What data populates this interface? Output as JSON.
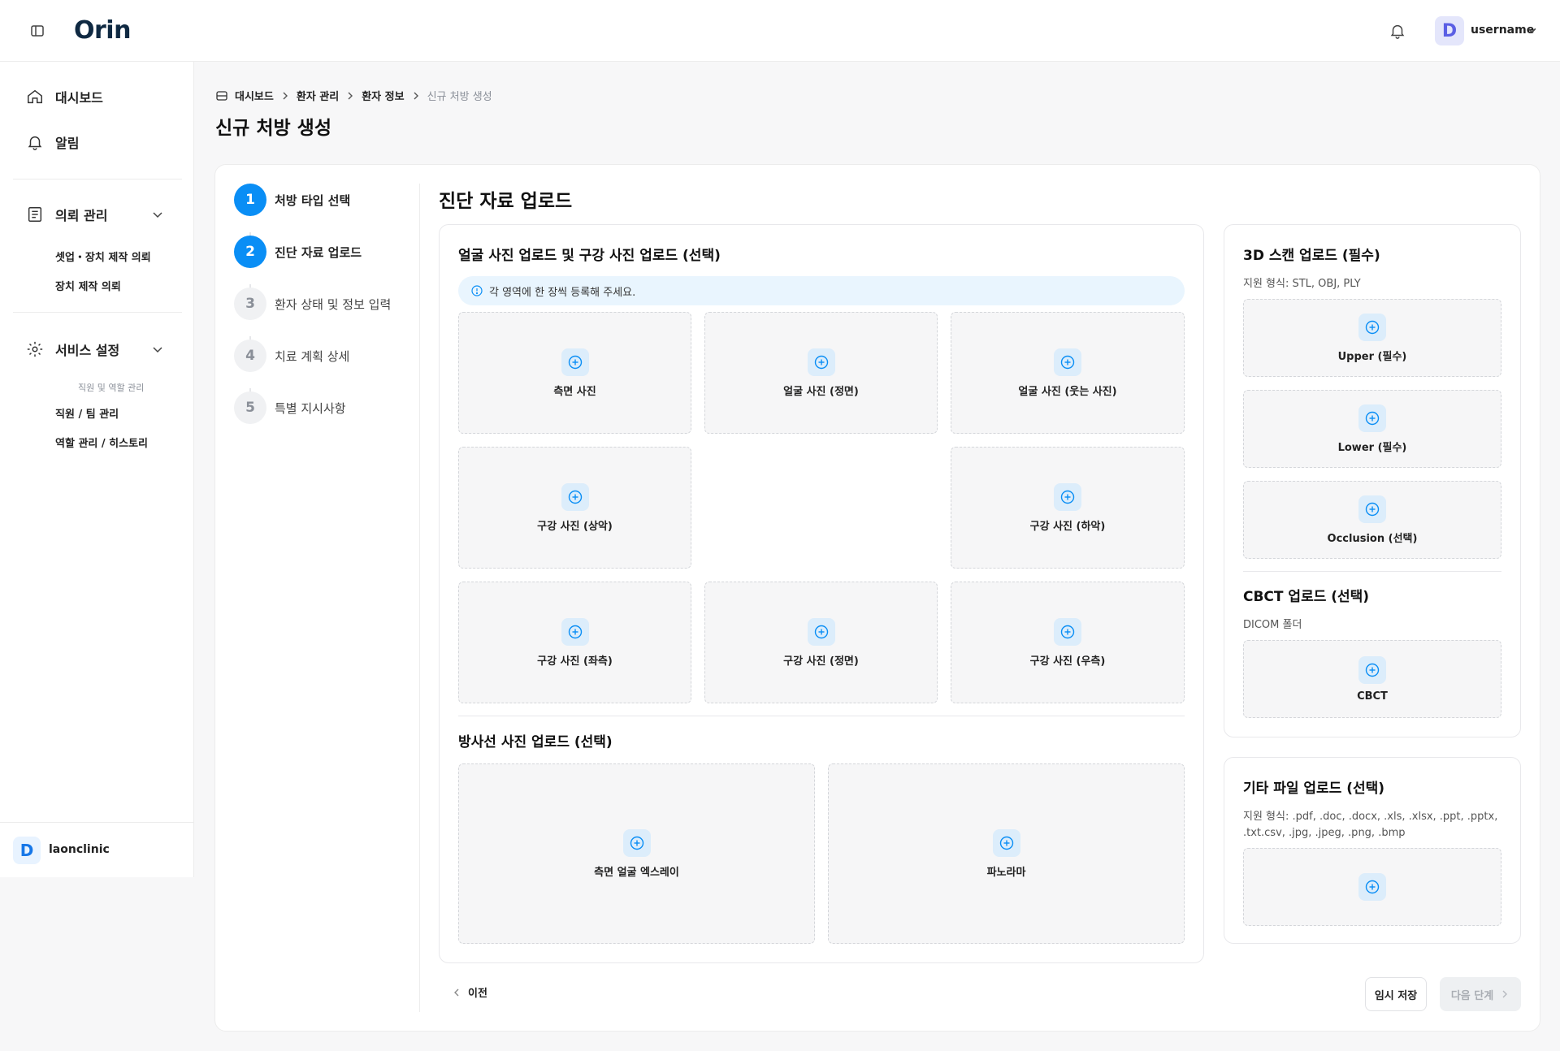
{
  "header": {
    "logo": "Orin",
    "user_initial": "D",
    "username": "username"
  },
  "sidebar": {
    "dashboard": "대시보드",
    "alerts": "알림",
    "request_group": "의뢰 관리",
    "request_items": [
      "셋업・장치 제작 의뢰",
      "장치 제작 의뢰"
    ],
    "settings_group": "서비스 설정",
    "settings_caption": "직원 및 역할 관리",
    "settings_items": [
      "직원 / 팀 관리",
      "역할 관리 / 히스토리"
    ],
    "clinic_initial": "D",
    "clinic_name": "laonclinic"
  },
  "breadcrumb": [
    "대시보드",
    "환자 관리",
    "환자 정보",
    "신규 처방 생성"
  ],
  "page_title": "신규 처방 생성",
  "steps": [
    {
      "num": "1",
      "label": "처방 타입 선택",
      "state": "active"
    },
    {
      "num": "2",
      "label": "진단 자료 업로드",
      "state": "active"
    },
    {
      "num": "3",
      "label": "환자 상태 및 정보 입력",
      "state": "pending"
    },
    {
      "num": "4",
      "label": "치료 계획 상세",
      "state": "pending"
    },
    {
      "num": "5",
      "label": "특별 지시사항",
      "state": "pending"
    }
  ],
  "section_title": "진단 자료 업로드",
  "photos": {
    "title": "얼굴 사진 업로드 및 구강 사진 업로드 (선택)",
    "notice": "각 영역에 한 장씩 등록해 주세요.",
    "slots": [
      "측면 사진",
      "얼굴 사진 (정면)",
      "얼굴 사진 (웃는 사진)",
      "구강 사진 (상악)",
      "구강 사진 (하악)",
      "구강 사진 (좌측)",
      "구강 사진 (정면)",
      "구강 사진 (우측)"
    ]
  },
  "xray": {
    "title": "방사선 사진 업로드 (선택)",
    "slots": [
      "측면 얼굴 엑스레이",
      "파노라마"
    ]
  },
  "scan3d": {
    "title": "3D 스캔 업로드 (필수)",
    "formats": "지원 형식: STL, OBJ, PLY",
    "slots": [
      "Upper (필수)",
      "Lower (필수)",
      "Occlusion (선택)"
    ]
  },
  "cbct": {
    "title": "CBCT 업로드 (선택)",
    "formats": "DICOM 폴더",
    "slot": "CBCT"
  },
  "other": {
    "title": "기타 파일 업로드 (선택)",
    "formats_line1": "지원 형식: .pdf, .doc, .docx, .xls, .xlsx, .ppt, .pptx,",
    "formats_line2": ".txt.csv, .jpg, .jpeg, .png, .bmp"
  },
  "buttons": {
    "prev": "이전",
    "save": "임시 저장",
    "next": "다음 단계"
  },
  "colors": {
    "accent": "#0a8ef5",
    "notice_bg": "#e9f5fe",
    "logo": "#0f2942"
  }
}
